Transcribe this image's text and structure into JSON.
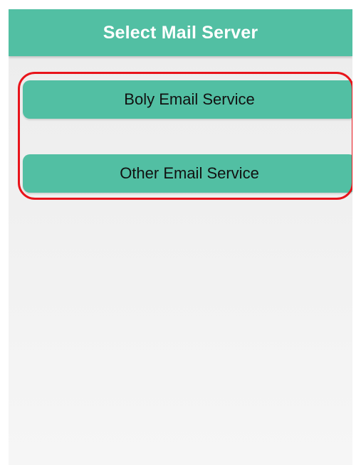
{
  "header": {
    "title": "Select Mail Server"
  },
  "options": [
    {
      "label": "Boly Email Service"
    },
    {
      "label": "Other Email Service"
    }
  ],
  "colors": {
    "accent": "#52bfa3",
    "highlight_outline": "#e8141b",
    "background": "#efefef"
  }
}
